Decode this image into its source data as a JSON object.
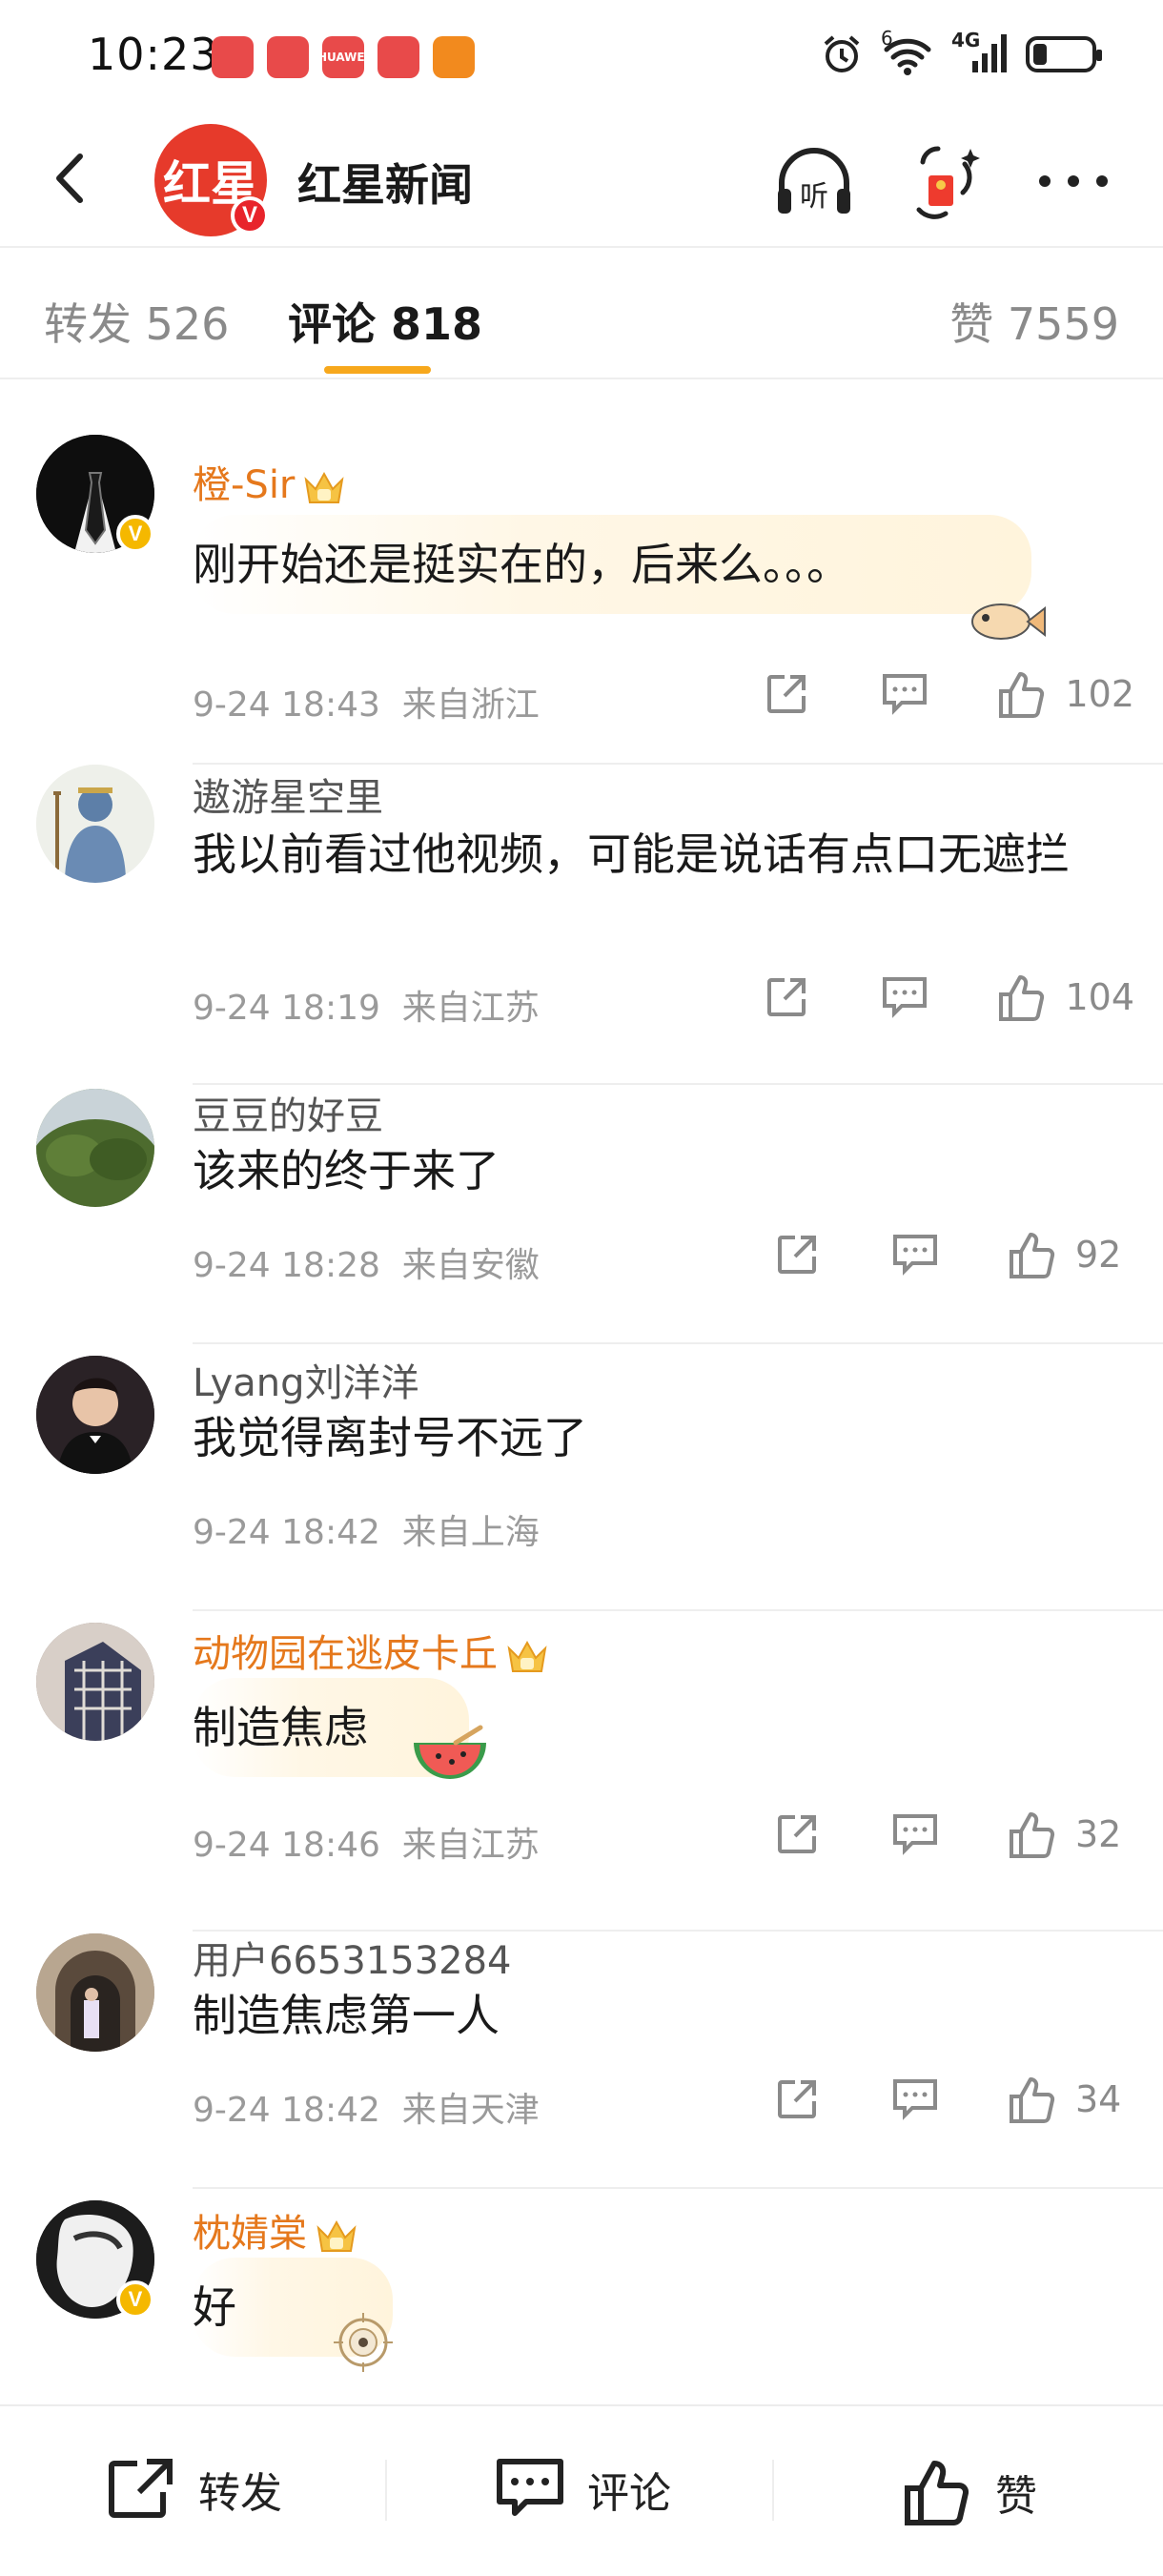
{
  "status_bar": {
    "time": "10:23",
    "apps": [
      "",
      "",
      "HUAWEI",
      "",
      ""
    ],
    "network": "4G",
    "wifi_slot": "6"
  },
  "header": {
    "logo_text": "红星",
    "title": "红星新闻",
    "listen_icon_label": "听"
  },
  "tabs": [
    {
      "label": "转发 526"
    },
    {
      "label": "评论 818"
    },
    {
      "label": "赞 7559"
    }
  ],
  "comments": [
    {
      "user": "橙-Sir",
      "vip": true,
      "verified": true,
      "text": "刚开始还是挺实在的，后来么。。。",
      "time": "9-24 18:43",
      "location": "来自浙江",
      "likes": "102"
    },
    {
      "user": "遨游星空里",
      "vip": false,
      "verified": false,
      "text": "我以前看过他视频，可能是说话有点口无遮拦",
      "time": "9-24 18:19",
      "location": "来自江苏",
      "likes": "104"
    },
    {
      "user": "豆豆的好豆",
      "vip": false,
      "verified": false,
      "text": "该来的终于来了",
      "time": "9-24 18:28",
      "location": "来自安徽",
      "likes": "92"
    },
    {
      "user": "Lyang刘洋洋",
      "vip": false,
      "verified": false,
      "text": "我觉得离封号不远了",
      "time": "9-24 18:42",
      "location": "来自上海",
      "likes": ""
    },
    {
      "user": "动物园在逃皮卡丘",
      "vip": true,
      "verified": false,
      "text": "制造焦虑",
      "time": "9-24 18:46",
      "location": "来自江苏",
      "likes": "32"
    },
    {
      "user": "用户6653153284",
      "vip": false,
      "verified": false,
      "text": "制造焦虑第一人",
      "time": "9-24 18:42",
      "location": "来自天津",
      "likes": "34"
    },
    {
      "user": "枕婧棠",
      "vip": true,
      "verified": true,
      "text": "好",
      "time": "",
      "location": "",
      "likes": ""
    }
  ],
  "bottom_bar": {
    "repost": "转发",
    "comment": "评论",
    "like": "赞"
  },
  "colors": {
    "accent": "#f7a81c",
    "vip_name": "#e5781c",
    "brand_red": "#e63a2b",
    "muted": "#9a9a9a"
  }
}
